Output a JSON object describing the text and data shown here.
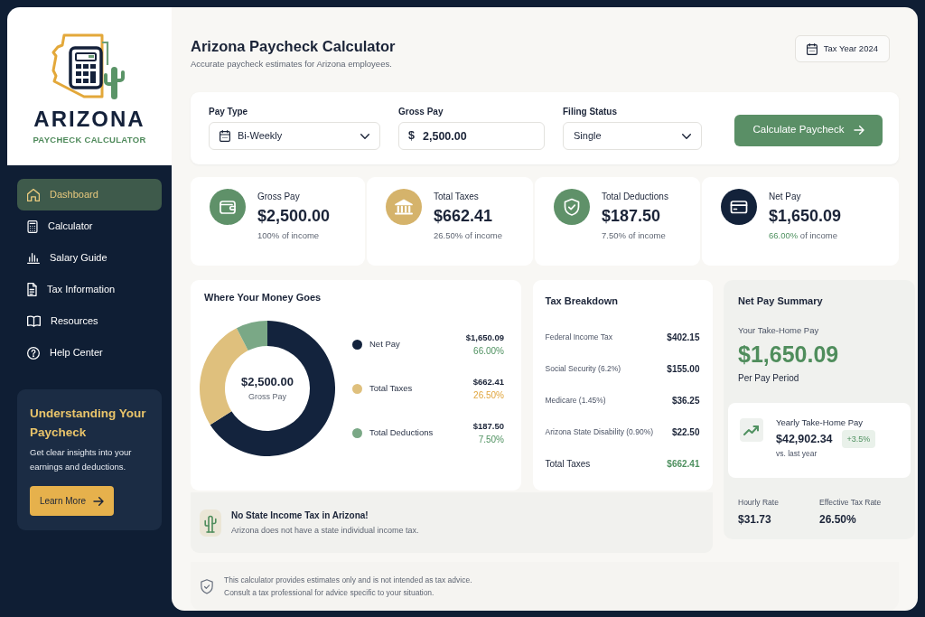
{
  "sidebar": {
    "logo": {
      "title": "ARIZONA",
      "subtitle": "PAYCHECK CALCULATOR"
    },
    "nav": [
      {
        "label": "Dashboard",
        "selected": true
      },
      {
        "label": "Calculator",
        "selected": false
      },
      {
        "label": "Salary Guide",
        "selected": false
      },
      {
        "label": "Tax Information",
        "selected": false
      },
      {
        "label": "Resources",
        "selected": false
      },
      {
        "label": "Help Center",
        "selected": false
      }
    ],
    "promo": {
      "title": "Understanding Your Paycheck",
      "text": "Get clear insights into your earnings and deductions.",
      "button": "Learn More"
    }
  },
  "header": {
    "title": "Arizona Paycheck Calculator",
    "subtitle": "Accurate paycheck estimates for Arizona employees.",
    "tax_year": "Tax Year 2024"
  },
  "form": {
    "fields": [
      {
        "kind": "select",
        "label": "Pay Type",
        "value": "Bi-Weekly"
      },
      {
        "kind": "currency",
        "label": "Gross Pay",
        "prefix": "$",
        "value": "2,500.00"
      },
      {
        "kind": "select",
        "label": "Filing Status",
        "value": "Single"
      }
    ],
    "button": "Calculate Paycheck"
  },
  "stats": [
    {
      "label": "Gross Pay",
      "value": "$2,500.00",
      "percent": "100%",
      "note": "of income",
      "highlight": false,
      "color": "#5f9169"
    },
    {
      "label": "Total Taxes",
      "value": "$662.41",
      "percent": "26.50%",
      "note": "of income",
      "highlight": false,
      "color": "#d5b36b"
    },
    {
      "label": "Total Deductions",
      "value": "$187.50",
      "percent": "7.50%",
      "note": "of income",
      "highlight": false,
      "color": "#5f9169"
    },
    {
      "label": "Net Pay",
      "value": "$1,650.09",
      "percent": "66.00%",
      "note": "of income",
      "highlight": true,
      "color": "#13223a"
    }
  ],
  "chart_card": {
    "title": "Where Your Money Goes",
    "center_value": "$2,500.00",
    "center_label": "Gross Pay",
    "chart_data": {
      "type": "donut",
      "categories": [
        "Net Pay",
        "Total Taxes",
        "Total Deductions"
      ],
      "values": [
        66.0,
        26.5,
        7.5
      ]
    },
    "legend": [
      {
        "amount": "$1,650.09",
        "percent": "66.00%",
        "color": "#13233d"
      },
      {
        "amount": "$662.41",
        "percent": "26.50%",
        "color": "#dfc07d"
      },
      {
        "amount": "$187.50",
        "percent": "7.50%",
        "color": "#7aa886"
      }
    ]
  },
  "notice": {
    "title": "No State Income Tax in Arizona!",
    "text": "Arizona does not have a state individual income tax."
  },
  "tax_breakdown": {
    "title": "Tax Breakdown",
    "rows": [
      {
        "label": "Federal Income Tax",
        "amount": "$402.15"
      },
      {
        "label": "Social Security (6.2%)",
        "amount": "$155.00"
      },
      {
        "label": "Medicare (1.45%)",
        "amount": "$36.25"
      },
      {
        "label": "Arizona State Disability (0.90%)",
        "amount": "$22.50"
      }
    ],
    "total": {
      "label": "Total Taxes",
      "amount": "$662.41"
    }
  },
  "net_summary": {
    "title": "Net Pay Summary",
    "take_home_label": "Your Take-Home Pay",
    "take_home": "$1,650.09",
    "period": "Per Pay Period",
    "yearly": {
      "label": "Yearly Take-Home Pay",
      "amount": "$42,902.34",
      "change": "+3.5%",
      "note": "vs. last year"
    },
    "metrics": [
      {
        "label": "Hourly Rate",
        "value": "$31.73"
      },
      {
        "label": "Effective Tax Rate",
        "value": "26.50%"
      }
    ]
  },
  "footer": {
    "lines": [
      "This calculator provides estimates only and is not intended as tax advice.",
      "Consult a tax professional for advice specific to your situation."
    ]
  }
}
